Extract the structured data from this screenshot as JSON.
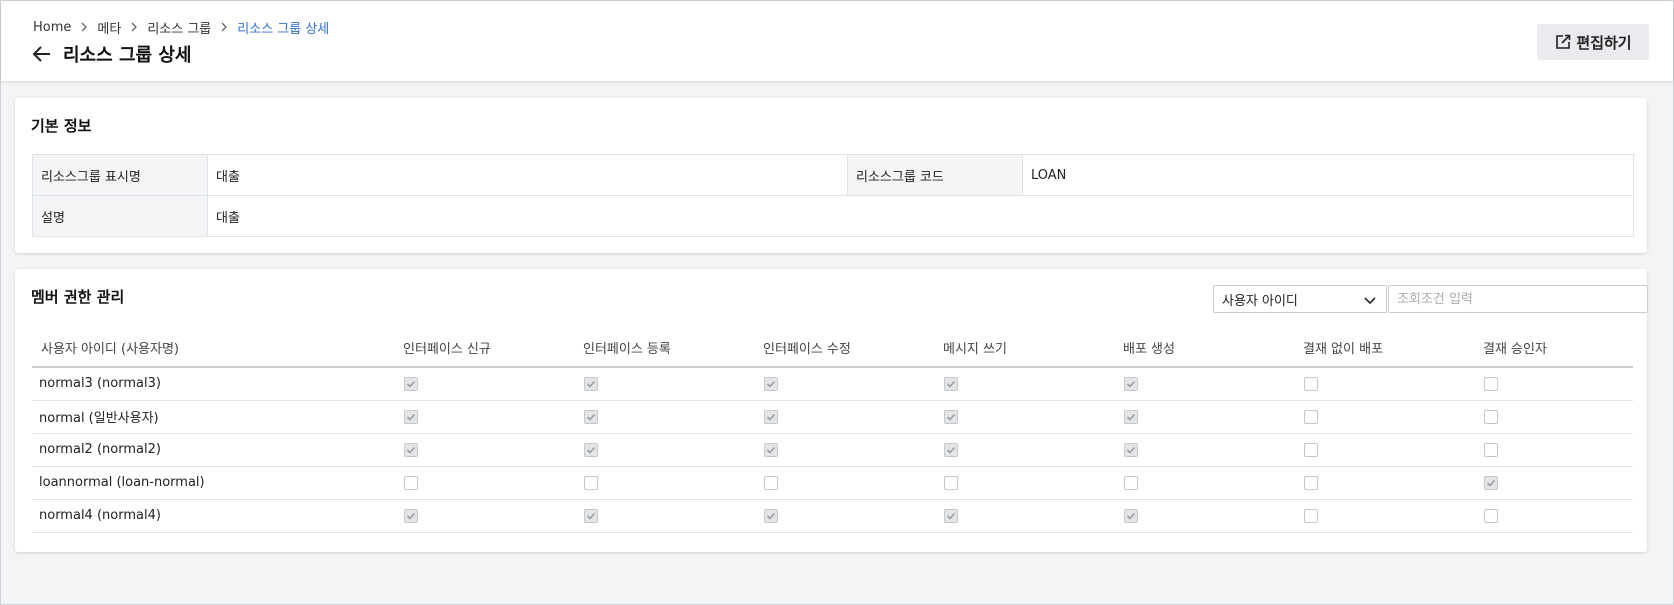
{
  "breadcrumb": [
    "Home",
    "메타",
    "리소스 그룹",
    "리소스 그룹 상세"
  ],
  "page_title": "리소스 그룹 상세",
  "edit_button_label": "편집하기",
  "basic_info": {
    "title": "기본 정보",
    "display_name_label": "리소스그룹 표시명",
    "display_name_value": "대출",
    "code_label": "리소스그룹 코드",
    "code_value": "LOAN",
    "description_label": "설명",
    "description_value": "대출"
  },
  "members": {
    "title": "멤버 권한 관리",
    "filter_select_value": "사용자 아이디",
    "filter_input_placeholder": "조회조건 입력",
    "columns": [
      "사용자 아이디 (사용자명)",
      "인터페이스 신규",
      "인터페이스 등록",
      "인터페이스 수정",
      "메시지 쓰기",
      "배포 생성",
      "결재 없이 배포",
      "결재 승인자"
    ],
    "rows": [
      {
        "user": "normal3 (normal3)",
        "perms": [
          true,
          true,
          true,
          true,
          true,
          false,
          false
        ]
      },
      {
        "user": "normal (일반사용자)",
        "perms": [
          true,
          true,
          true,
          true,
          true,
          false,
          false
        ]
      },
      {
        "user": "normal2 (normal2)",
        "perms": [
          true,
          true,
          true,
          true,
          true,
          false,
          false
        ]
      },
      {
        "user": "loannormal (loan-normal)",
        "perms": [
          false,
          false,
          false,
          false,
          false,
          false,
          true
        ]
      },
      {
        "user": "normal4 (normal4)",
        "perms": [
          true,
          true,
          true,
          true,
          true,
          false,
          false
        ]
      }
    ]
  },
  "colors": {
    "link_blue": "#2f6fd6",
    "page_bg": "#f3f4f6",
    "label_bg": "#f4f5f7"
  }
}
